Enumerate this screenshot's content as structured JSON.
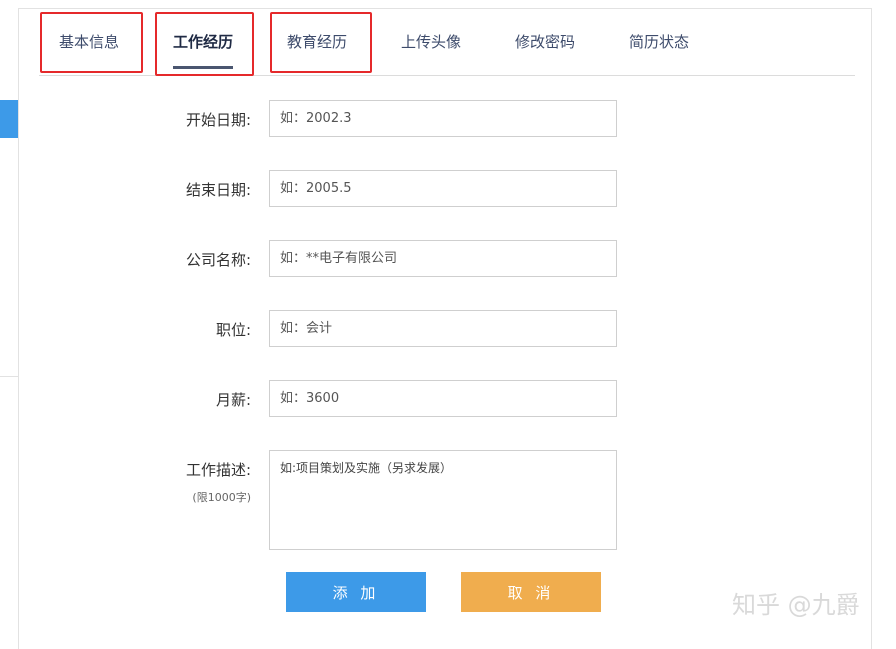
{
  "tabs": [
    {
      "label": "基本信息"
    },
    {
      "label": "工作经历"
    },
    {
      "label": "教育经历"
    },
    {
      "label": "上传头像"
    },
    {
      "label": "修改密码"
    },
    {
      "label": "简历状态"
    }
  ],
  "active_tab": "工作经历",
  "form": {
    "start_date": {
      "label": "开始日期:",
      "placeholder": "如：2002.3",
      "value": ""
    },
    "end_date": {
      "label": "结束日期:",
      "placeholder": "如：2005.5",
      "value": ""
    },
    "company": {
      "label": "公司名称:",
      "placeholder": "如：**电子有限公司",
      "value": ""
    },
    "position": {
      "label": "职位:",
      "placeholder": "如：会计",
      "value": ""
    },
    "salary": {
      "label": "月薪:",
      "placeholder": "如：3600",
      "value": ""
    },
    "description": {
      "label": "工作描述:",
      "sublabel": "(限1000字)",
      "placeholder": "如:项目策划及实施（另求发展）",
      "value": ""
    }
  },
  "buttons": {
    "add": "添 加",
    "cancel": "取 消"
  },
  "watermark": "知乎 @九爵",
  "colors": {
    "primary": "#3d9ae8",
    "warning": "#f0ad4e",
    "highlight": "#e5292b",
    "tab_text": "#3d4b6b"
  }
}
